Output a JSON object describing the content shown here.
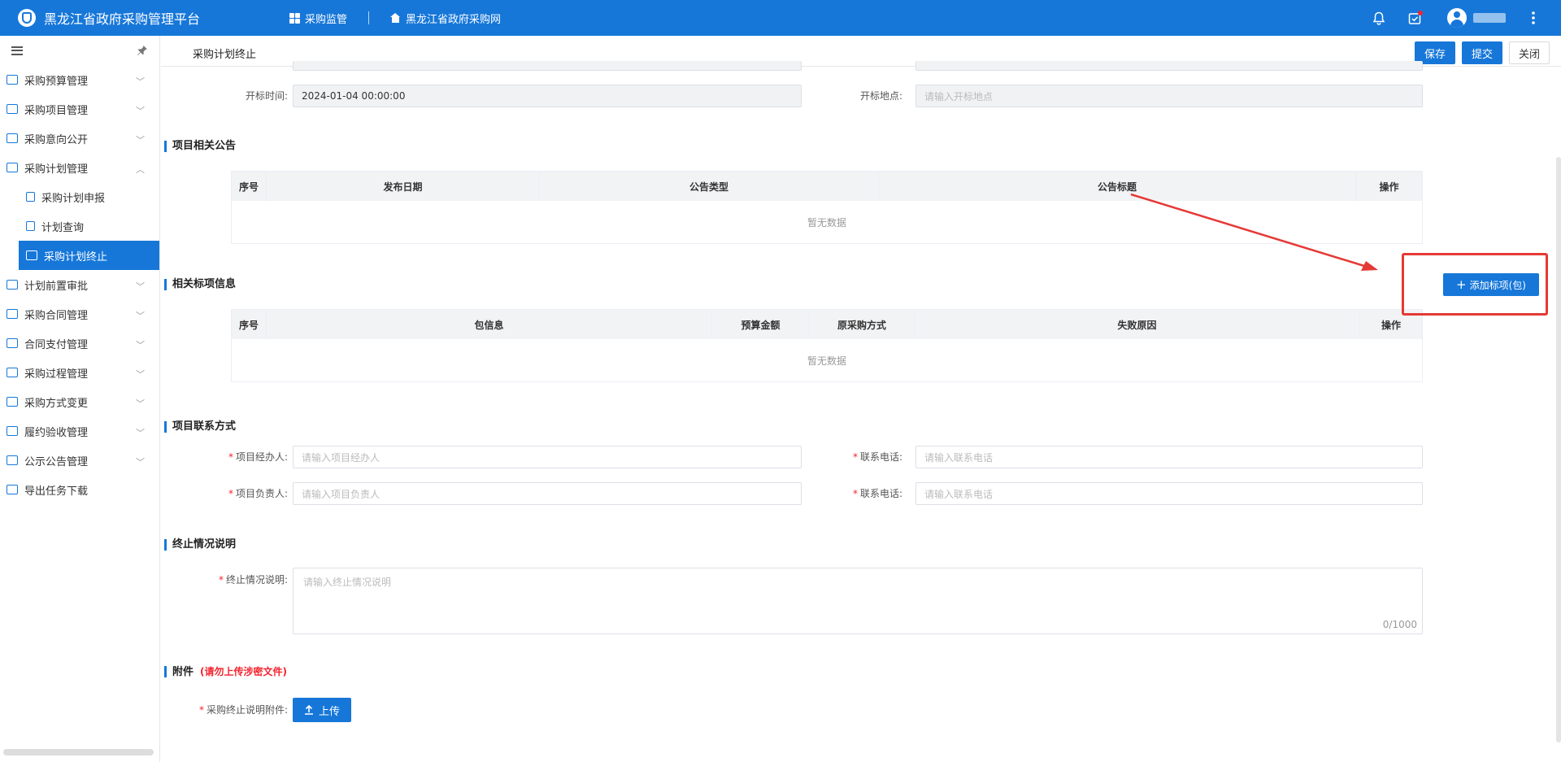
{
  "app": {
    "title": "黑龙江省政府采购管理平台"
  },
  "topnav": {
    "item1": "采购监管",
    "item2": "黑龙江省政府采购网"
  },
  "sidebar": {
    "items": [
      {
        "label": "采购预算管理",
        "chevron": "﹀"
      },
      {
        "label": "采购项目管理",
        "chevron": "﹀"
      },
      {
        "label": "采购意向公开",
        "chevron": "﹀"
      },
      {
        "label": "采购计划管理",
        "chevron": "︿"
      },
      {
        "label": "采购计划申报"
      },
      {
        "label": "计划查询"
      },
      {
        "label": "采购计划终止"
      },
      {
        "label": "计划前置审批",
        "chevron": "﹀"
      },
      {
        "label": "采购合同管理",
        "chevron": "﹀"
      },
      {
        "label": "合同支付管理",
        "chevron": "﹀"
      },
      {
        "label": "采购过程管理",
        "chevron": "﹀"
      },
      {
        "label": "采购方式变更",
        "chevron": "﹀"
      },
      {
        "label": "履约验收管理",
        "chevron": "﹀"
      },
      {
        "label": "公示公告管理",
        "chevron": "﹀"
      },
      {
        "label": "导出任务下载"
      }
    ]
  },
  "header": {
    "title": "采购计划终止",
    "save": "保存",
    "submit": "提交",
    "close": "关闭"
  },
  "bid": {
    "open_time_label": "开标时间:",
    "open_time_value": "2024-01-04 00:00:00",
    "open_place_label": "开标地点:",
    "open_place_placeholder": "请输入开标地点"
  },
  "notices": {
    "title": "项目相关公告",
    "columns": [
      "序号",
      "发布日期",
      "公告类型",
      "公告标题",
      "操作"
    ],
    "empty": "暂无数据"
  },
  "lots": {
    "title": "相关标项信息",
    "add_button": "添加标项(包)",
    "columns": [
      "序号",
      "包信息",
      "预算金额",
      "原采购方式",
      "失败原因",
      "操作"
    ],
    "empty": "暂无数据"
  },
  "contact": {
    "title": "项目联系方式",
    "manager_label": "项目经办人:",
    "manager_placeholder": "请输入项目经办人",
    "phone1_label": "联系电话:",
    "phone1_placeholder": "请输入联系电话",
    "owner_label": "项目负责人:",
    "owner_placeholder": "请输入项目负责人",
    "phone2_label": "联系电话:",
    "phone2_placeholder": "请输入联系电话"
  },
  "termination": {
    "title": "终止情况说明",
    "label": "终止情况说明:",
    "placeholder": "请输入终止情况说明",
    "counter": "0/1000"
  },
  "attachment": {
    "title": "附件",
    "warning": "(请勿上传涉密文件)",
    "label": "采购终止说明附件:",
    "upload": "上传"
  },
  "colors": {
    "brand": "#1677d9",
    "required": "#f5222d",
    "annotation": "#e53935"
  }
}
